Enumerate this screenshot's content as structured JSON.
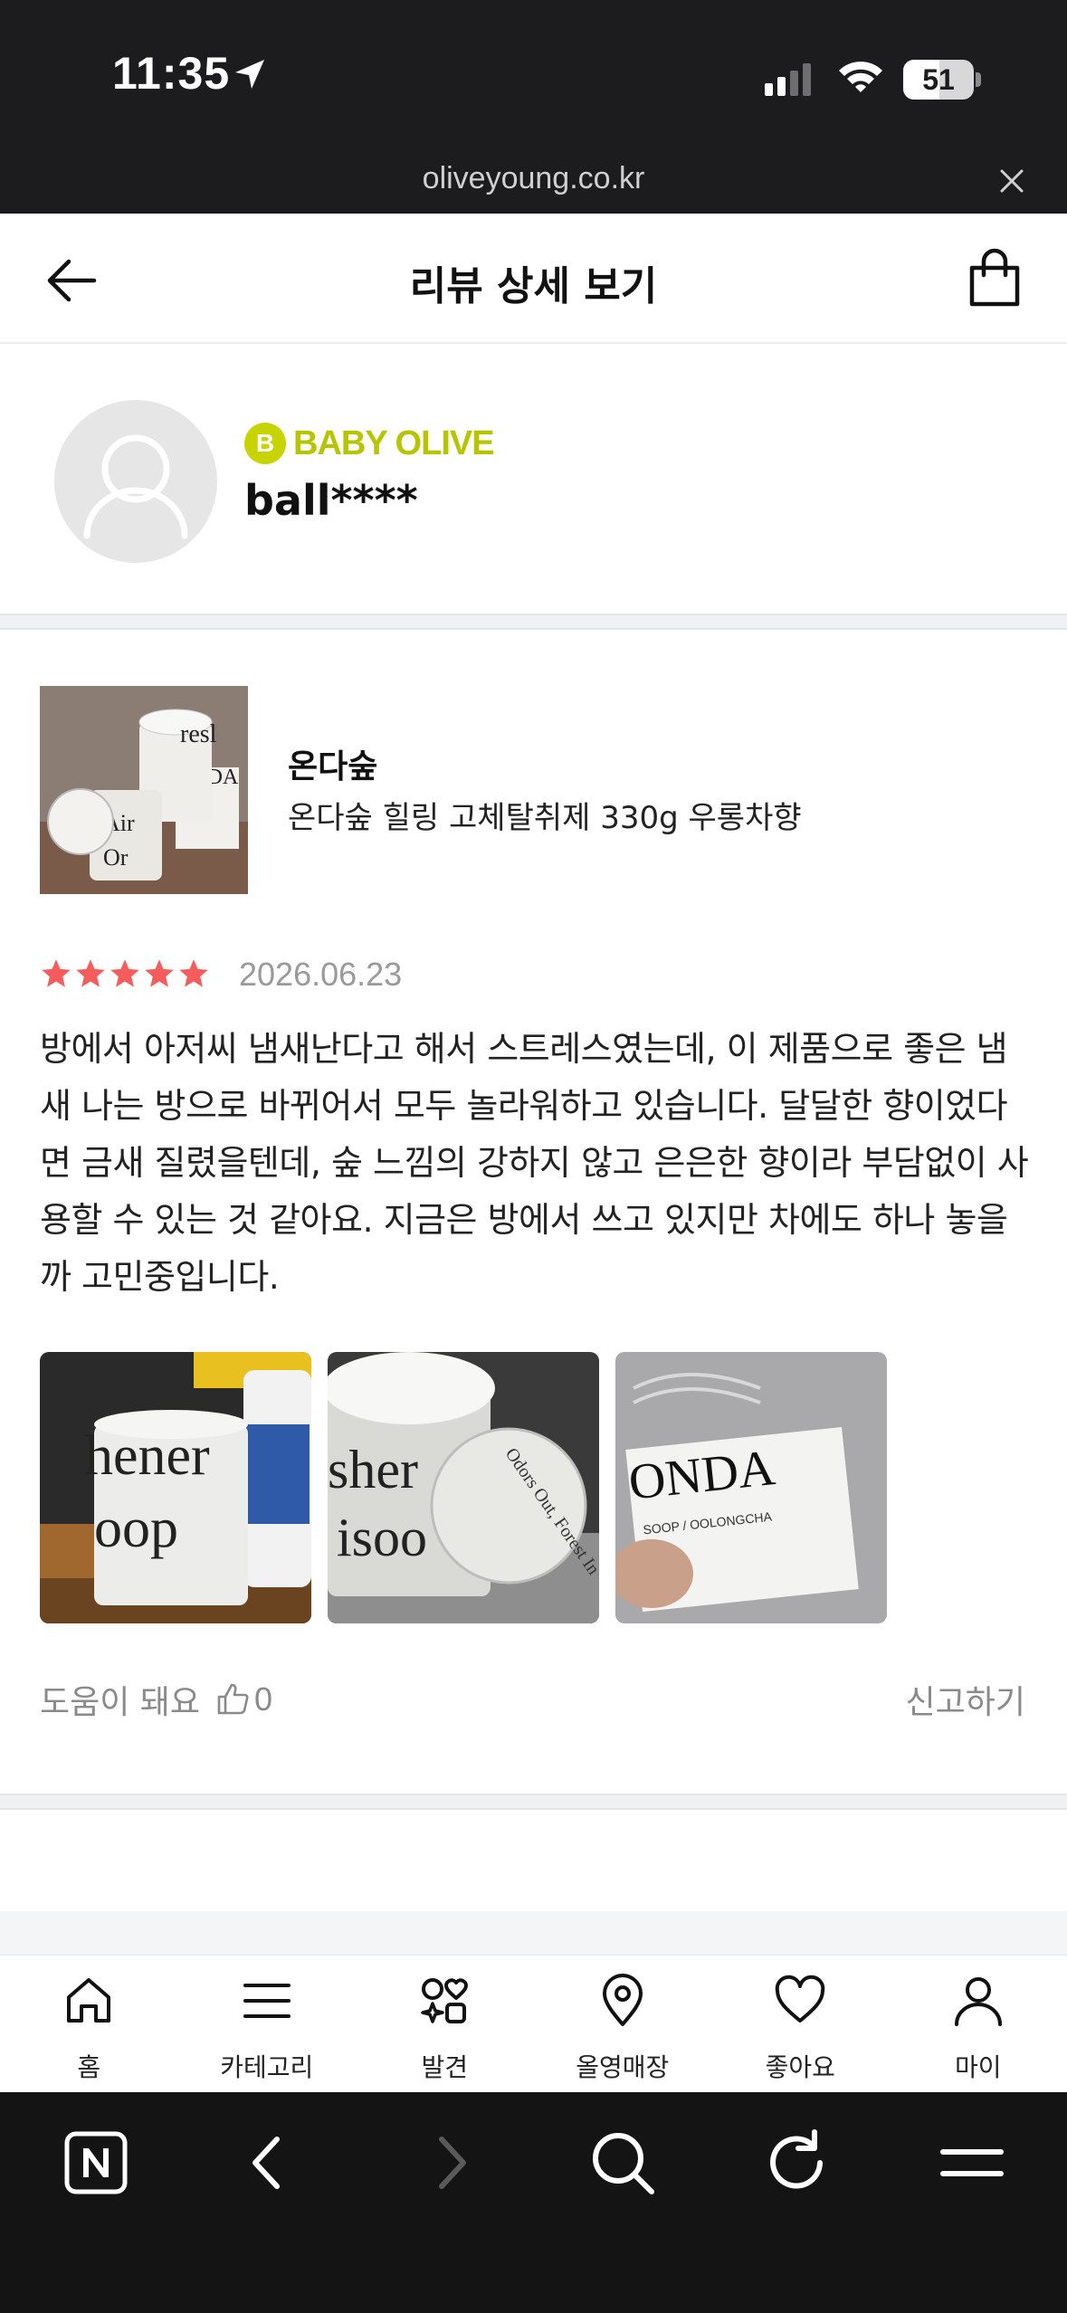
{
  "status_bar": {
    "time": "11:35",
    "battery": "51",
    "battery_level": 0.51
  },
  "browser": {
    "url": "oliveyoung.co.kr"
  },
  "header": {
    "title": "리뷰 상세 보기"
  },
  "reviewer": {
    "grade_badge": "B",
    "grade": "BABY OLIVE",
    "username": "ball****"
  },
  "product": {
    "brand": "온다숲",
    "name": "온다숲 힐링 고체탈취제 330g 우롱차향"
  },
  "review": {
    "rating": 5,
    "star_color": "#f65c5c",
    "date": "2026.06.23",
    "text": "방에서 아저씨 냄새난다고 해서 스트레스였는데, 이 제품으로 좋은 냄새 나는 방으로 바뀌어서 모두 놀라워하고 있습니다. 달달한 향이었다면 금새 질렸을텐데, 숲 느낌의 강하지 않고 은은한 향이라 부담없이 사용할 수 있는 것 같아요. 지금은 방에서 쓰고 있지만 차에도 하나 놓을까 고민중입니다.",
    "helpful_label": "도움이 돼요",
    "helpful_count": "0",
    "report_label": "신고하기"
  },
  "bottom_nav": [
    {
      "label": "홈",
      "icon": "home-icon"
    },
    {
      "label": "카테고리",
      "icon": "menu-icon"
    },
    {
      "label": "발견",
      "icon": "discover-icon"
    },
    {
      "label": "올영매장",
      "icon": "location-pin-icon"
    },
    {
      "label": "좋아요",
      "icon": "heart-icon"
    },
    {
      "label": "마이",
      "icon": "person-icon"
    }
  ],
  "browser_toolbar": [
    "naver-n-icon",
    "back-icon",
    "forward-icon",
    "search-icon",
    "refresh-icon",
    "menu-icon"
  ]
}
